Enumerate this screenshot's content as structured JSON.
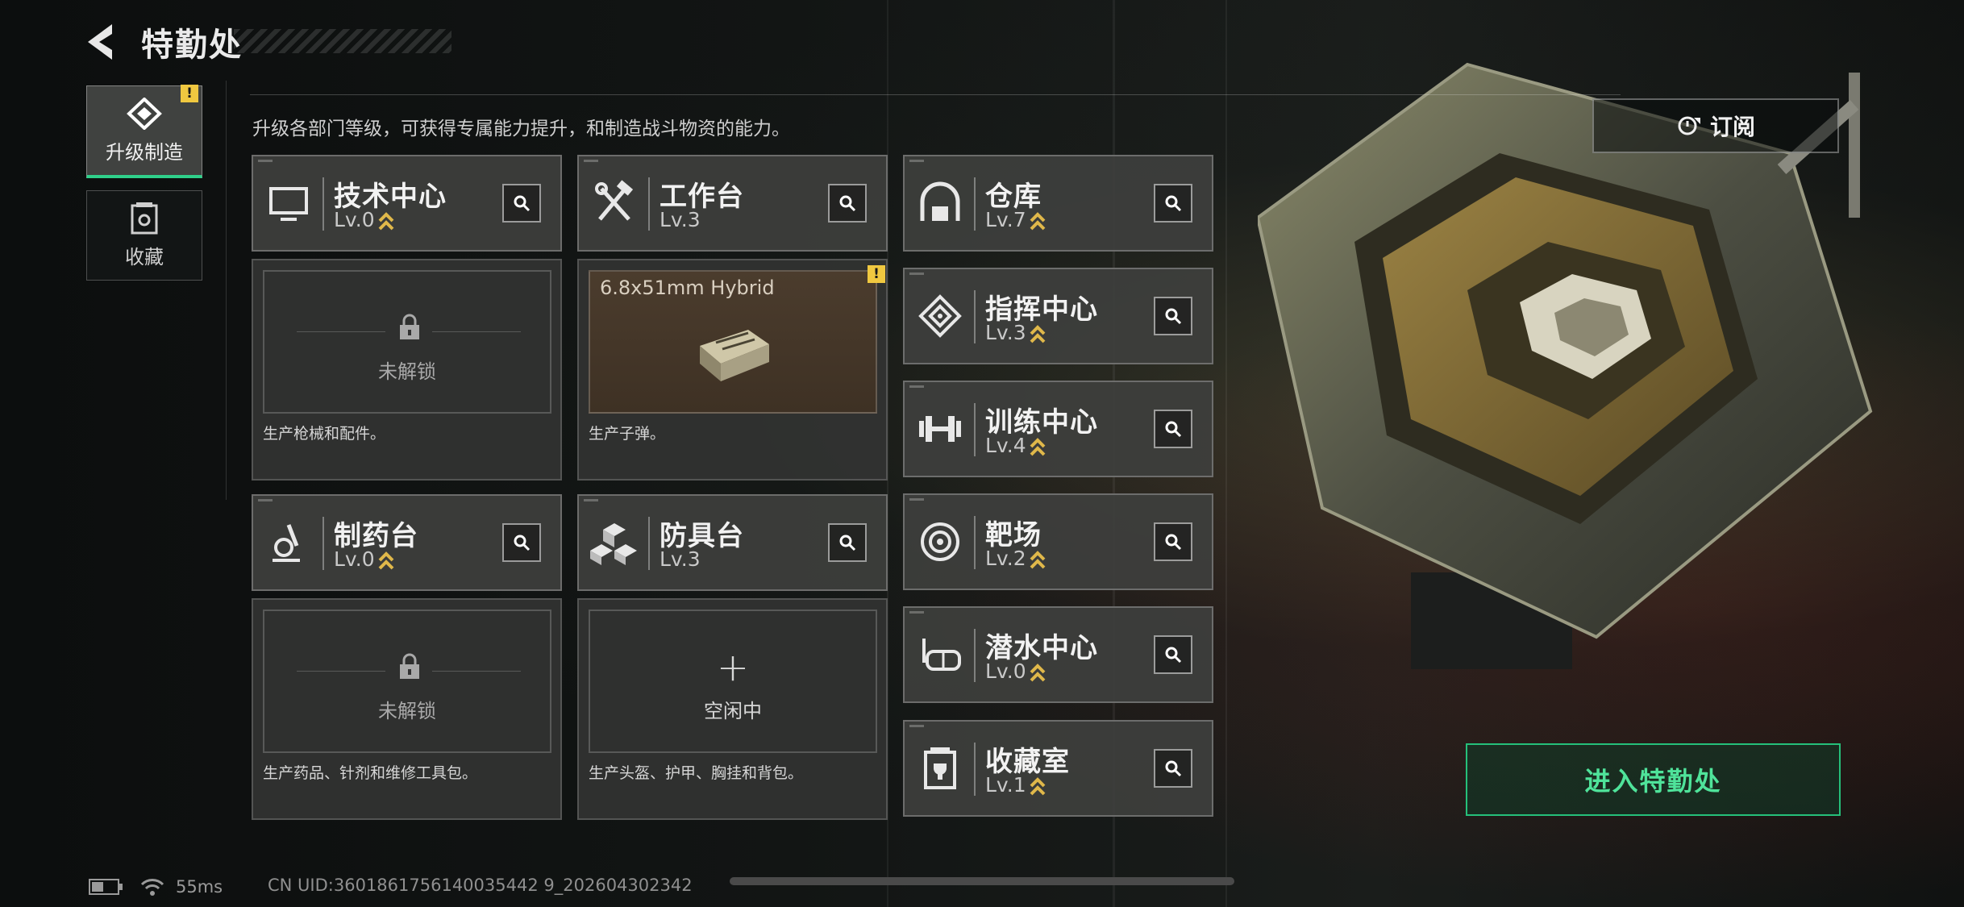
{
  "header": {
    "title": "特勤处"
  },
  "nav": [
    {
      "label": "升级制造",
      "active": true,
      "badge": "!"
    },
    {
      "label": "收藏",
      "active": false
    }
  ],
  "description": "升级各部门等级，可获得专属能力提升，和制造战斗物资的能力。",
  "departments": {
    "tech_center": {
      "name": "技术中心",
      "level": "Lv.0",
      "locked_text": "未解锁",
      "footer": "生产枪械和配件。"
    },
    "workbench": {
      "name": "工作台",
      "level": "Lv.3",
      "crafting_item": "6.8x51mm Hybrid",
      "footer": "生产子弹。",
      "badge": "!"
    },
    "pharmacy": {
      "name": "制药台",
      "level": "Lv.0",
      "locked_text": "未解锁",
      "footer": "生产药品、针剂和维修工具包。"
    },
    "armor_bench": {
      "name": "防具台",
      "level": "Lv.3",
      "idle_plus": "+",
      "idle_text": "空闲中",
      "footer": "生产头盔、护甲、胸挂和背包。"
    },
    "warehouse": {
      "name": "仓库",
      "level": "Lv.7"
    },
    "command_center": {
      "name": "指挥中心",
      "level": "Lv.3"
    },
    "training_center": {
      "name": "训练中心",
      "level": "Lv.4"
    },
    "shooting_range": {
      "name": "靶场",
      "level": "Lv.2"
    },
    "diving_center": {
      "name": "潜水中心",
      "level": "Lv.0"
    },
    "collection_room": {
      "name": "收藏室",
      "level": "Lv.1"
    }
  },
  "buttons": {
    "subscribe": "订阅",
    "enter": "进入特勤处"
  },
  "status": {
    "ping": "55ms",
    "uid": "CN UID:3601861756140035442 9_202604302342"
  },
  "colors": {
    "accent_green": "#25c07a",
    "upgrade_gold": "#e0b84a",
    "badge_yellow": "#f0c840"
  }
}
